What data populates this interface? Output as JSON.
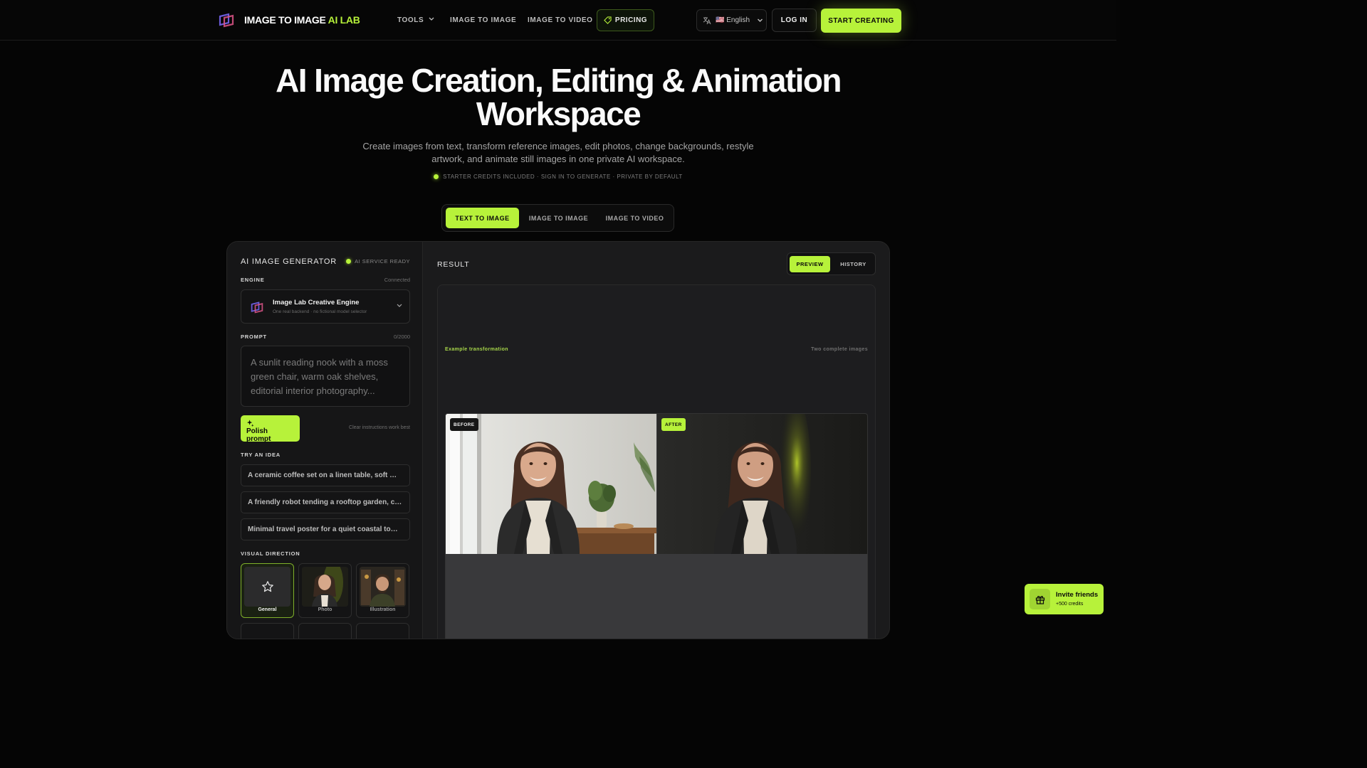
{
  "nav": {
    "brand_main": "IMAGE TO IMAGE",
    "brand_accent": "AI LAB",
    "tools": "TOOLS",
    "image_to_image": "IMAGE TO IMAGE",
    "image_to_video": "IMAGE TO VIDEO",
    "pricing": "PRICING",
    "language": "🇺🇸 English",
    "login": "LOG IN",
    "start": "START CREATING"
  },
  "hero": {
    "title_line1": "AI Image Creation, Editing & Animation",
    "title_line2": "Workspace",
    "subtitle": "Create images from text, transform reference images, edit photos, change backgrounds, restyle artwork, and animate still images in one private AI workspace.",
    "badge": "STARTER CREDITS INCLUDED · SIGN IN TO GENERATE · PRIVATE BY DEFAULT"
  },
  "mode_tabs": [
    {
      "label": "TEXT TO IMAGE",
      "active": true
    },
    {
      "label": "IMAGE TO IMAGE",
      "active": false
    },
    {
      "label": "IMAGE TO VIDEO",
      "active": false
    }
  ],
  "generator": {
    "title": "AI IMAGE GENERATOR",
    "status": "AI SERVICE READY",
    "engine_label": "ENGINE",
    "engine_status": "Connected",
    "engine_name": "Image Lab Creative Engine",
    "engine_sub": "One real backend · no fictional model selector",
    "prompt_label": "PROMPT",
    "prompt_count": "0/2000",
    "prompt_placeholder": "A sunlit reading nook with a moss green chair, warm oak shelves, editorial interior photography...",
    "polish_label": "Polish prompt",
    "hint": "Clear instructions work best",
    "ideas_label": "TRY AN IDEA",
    "ideas": [
      "A ceramic coffee set on a linen table, soft morning light",
      "A friendly robot tending a rooftop garden, cozy afternoon",
      "Minimal travel poster for a quiet coastal town at dusk"
    ],
    "direction_label": "VISUAL DIRECTION",
    "directions": [
      {
        "label": "General",
        "icon": "star-icon",
        "active": true
      },
      {
        "label": "Photo",
        "active": false
      },
      {
        "label": "Illustration",
        "active": false
      }
    ]
  },
  "result": {
    "title": "RESULT",
    "preview": "PREVIEW",
    "history": "HISTORY",
    "example_label": "Example transformation",
    "example_right": "Two complete images",
    "before_tag": "BEFORE",
    "after_tag": "AFTER"
  },
  "invite": {
    "title": "Invite friends",
    "sub": "+500 credits"
  },
  "colors": {
    "accent": "#b7f23a",
    "background": "#050505",
    "panel": "#1b1b1c"
  }
}
